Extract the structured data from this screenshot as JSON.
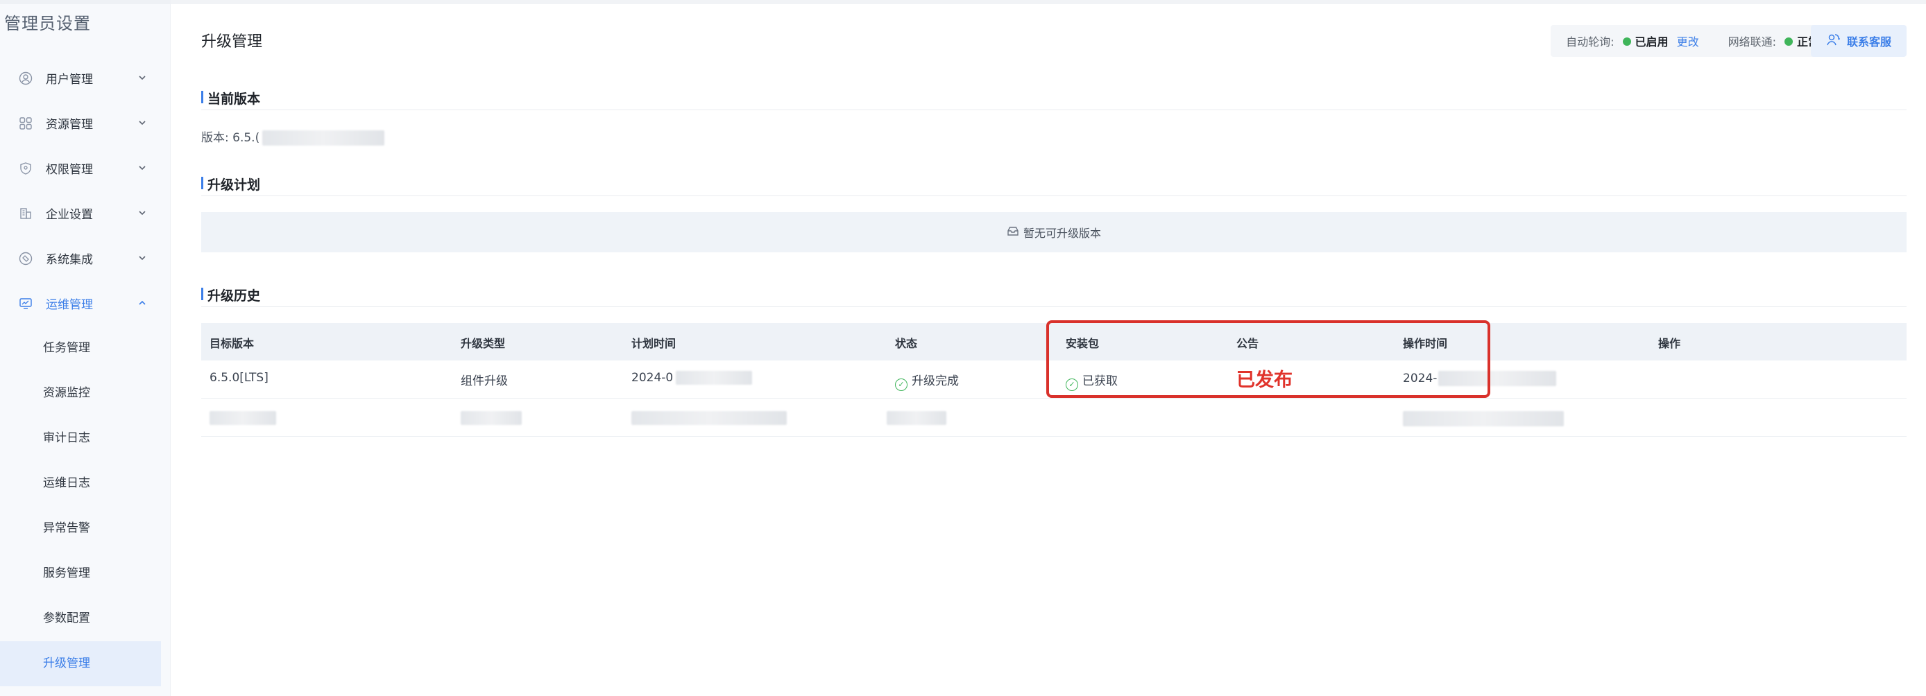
{
  "sidebar": {
    "title": "管理员设置",
    "items": [
      {
        "label": "用户管理",
        "icon": "user-icon"
      },
      {
        "label": "资源管理",
        "icon": "grid-icon"
      },
      {
        "label": "权限管理",
        "icon": "shield-icon"
      },
      {
        "label": "企业设置",
        "icon": "building-icon"
      },
      {
        "label": "系统集成",
        "icon": "integration-icon"
      },
      {
        "label": "运维管理",
        "icon": "monitor-icon"
      }
    ],
    "submenu": [
      "任务管理",
      "资源监控",
      "审计日志",
      "运维日志",
      "异常告警",
      "服务管理",
      "参数配置",
      "升级管理"
    ]
  },
  "header": {
    "title": "升级管理",
    "auto_poll_label": "自动轮询:",
    "auto_poll_status": "已启用",
    "change_link": "更改",
    "network_label": "网络联通:",
    "network_status": "正常",
    "contact_button": "联系客服"
  },
  "current_version": {
    "heading": "当前版本",
    "prefix": "版本: 6.5.("
  },
  "upgrade_plan": {
    "heading": "升级计划",
    "empty_text": "暂无可升级版本"
  },
  "history": {
    "heading": "升级历史",
    "columns": [
      "目标版本",
      "升级类型",
      "计划时间",
      "状态",
      "安装包",
      "公告",
      "操作时间",
      "操作"
    ],
    "rows": [
      {
        "target_version": "6.5.0[LTS]",
        "type": "组件升级",
        "plan_time": "2024-0",
        "status": "升级完成",
        "package": "已获取",
        "notice": "已发布",
        "op_time": "2024-"
      }
    ]
  },
  "colors": {
    "accent": "#3b7ee8",
    "success": "#3fb55a",
    "highlight": "#d9312b"
  }
}
